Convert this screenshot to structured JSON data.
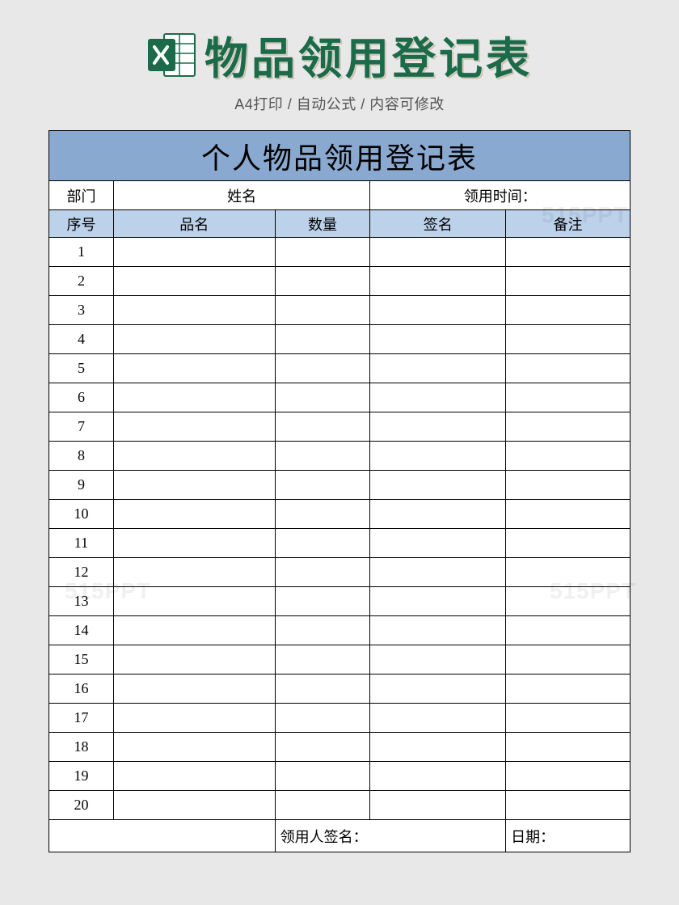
{
  "header": {
    "title": "物品领用登记表",
    "subtitle": "A4打印 / 自动公式 / 内容可修改"
  },
  "sheet": {
    "title": "个人物品领用登记表",
    "info": {
      "dept_label": "部门",
      "name_label": "姓名",
      "time_label": "领用时间："
    },
    "columns": {
      "seq": "序号",
      "item": "品名",
      "qty": "数量",
      "sign": "签名",
      "note": "备注"
    },
    "rows": [
      {
        "seq": "1"
      },
      {
        "seq": "2"
      },
      {
        "seq": "3"
      },
      {
        "seq": "4"
      },
      {
        "seq": "5"
      },
      {
        "seq": "6"
      },
      {
        "seq": "7"
      },
      {
        "seq": "8"
      },
      {
        "seq": "9"
      },
      {
        "seq": "10"
      },
      {
        "seq": "11"
      },
      {
        "seq": "12"
      },
      {
        "seq": "13"
      },
      {
        "seq": "14"
      },
      {
        "seq": "15"
      },
      {
        "seq": "16"
      },
      {
        "seq": "17"
      },
      {
        "seq": "18"
      },
      {
        "seq": "19"
      },
      {
        "seq": "20"
      }
    ],
    "footer": {
      "signer_label": "领用人签名：",
      "date_label": "日期："
    }
  },
  "watermark": "515PPT"
}
